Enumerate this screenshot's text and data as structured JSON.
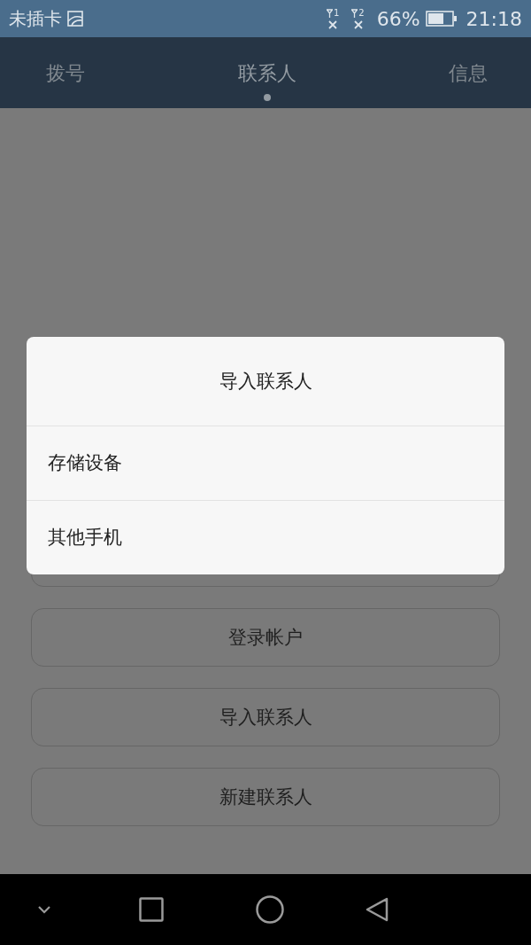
{
  "status_bar": {
    "carrier": "未插卡",
    "sim_1": "1",
    "sim_2": "2",
    "battery": "66%",
    "time": "21:18"
  },
  "tabs": [
    {
      "label": "拨号",
      "selected": false
    },
    {
      "label": "联系人",
      "selected": true
    },
    {
      "label": "信息",
      "selected": false
    }
  ],
  "buttons": [
    {
      "kind": "blank"
    },
    {
      "kind": "text",
      "label": "登录帐户"
    },
    {
      "kind": "text",
      "label": "导入联系人"
    },
    {
      "kind": "text",
      "label": "新建联系人"
    }
  ],
  "dialog": {
    "title": "导入联系人",
    "options": [
      "存储设备",
      "其他手机"
    ]
  }
}
